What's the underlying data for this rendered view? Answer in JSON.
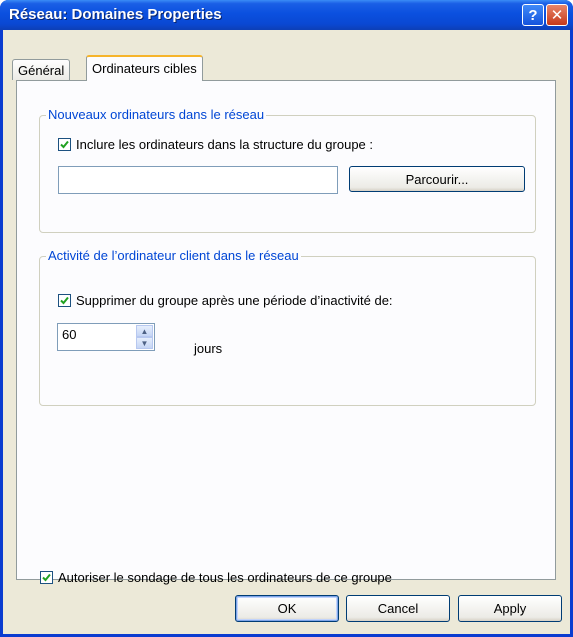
{
  "window": {
    "title": "Réseau: Domaines Properties",
    "help_label": "?",
    "close_label": "✕"
  },
  "tabs": [
    {
      "label": "Général",
      "active": false
    },
    {
      "label": "Ordinateurs cibles",
      "active": true
    }
  ],
  "group_new": {
    "title": "Nouveaux ordinateurs dans le réseau",
    "include_checkbox": {
      "label": "Inclure les ordinateurs dans la structure du groupe :",
      "checked": true
    },
    "path_value": "",
    "browse_label": "Parcourir..."
  },
  "group_activity": {
    "title": "Activité de l’ordinateur client dans le réseau",
    "remove_checkbox": {
      "label": "Supprimer du groupe après une période d’inactivité de:",
      "checked": true
    },
    "days_value": "60",
    "days_unit": "jours"
  },
  "allow_poll_checkbox": {
    "label": "Autoriser le sondage de tous les ordinateurs de ce groupe",
    "checked": true
  },
  "footer": {
    "ok_label": "OK",
    "cancel_label": "Cancel",
    "apply_label": "Apply"
  },
  "colors": {
    "titlebar": "#0a48d3",
    "group_title": "#0046d5",
    "checkmark": "#21a121",
    "dialog_bg": "#ece9d8"
  }
}
